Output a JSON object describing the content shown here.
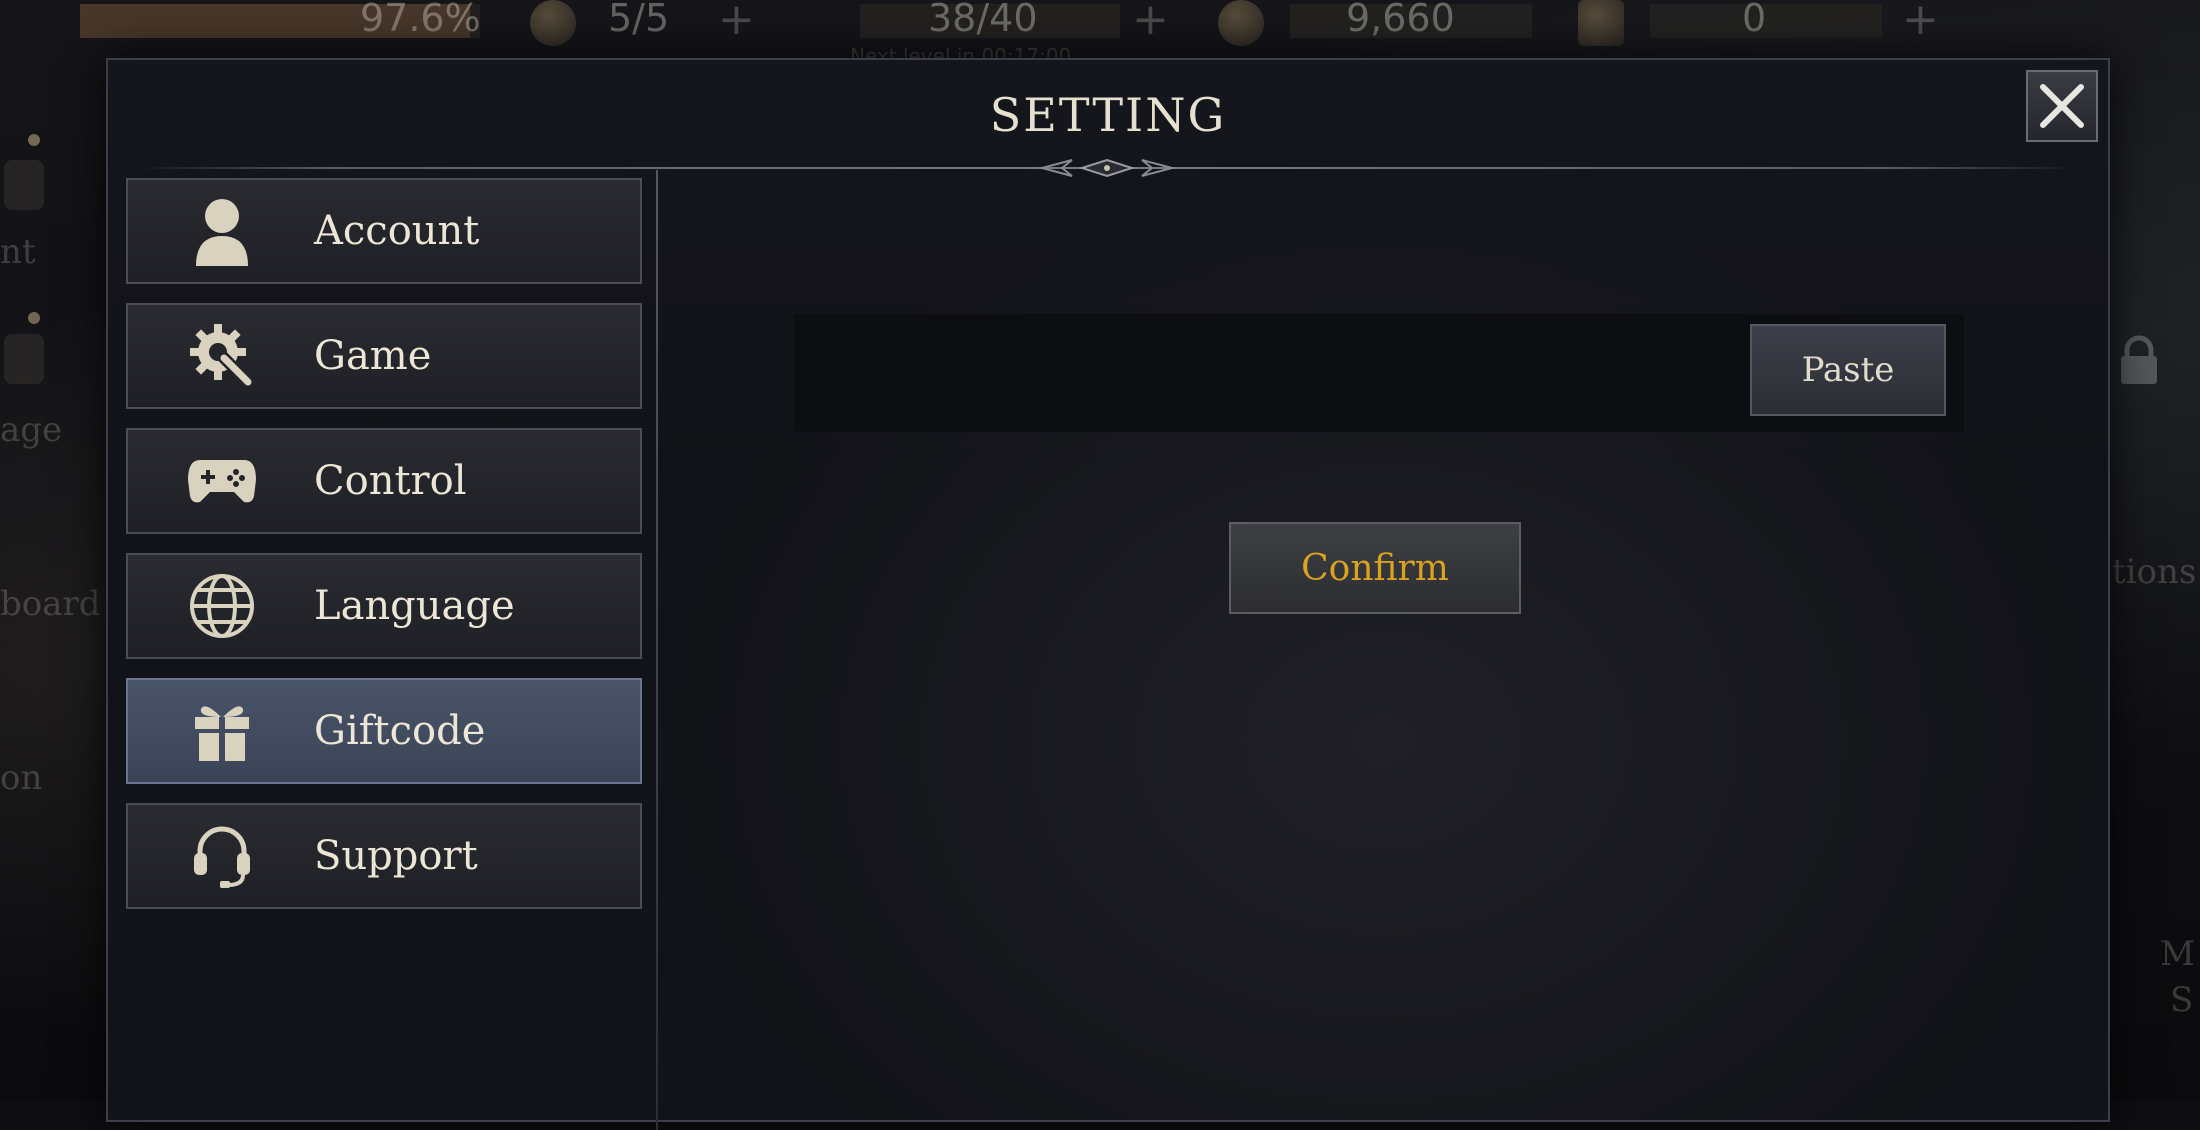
{
  "hud": {
    "progress_text": "97.6%",
    "stamina_text": "5/5",
    "energy_text": "38/40",
    "gold_text": "9,660",
    "gems_text": "0",
    "next_text": "Next level in 00:17:00"
  },
  "dialog": {
    "title": "SETTING",
    "nav_items": [
      {
        "label": "Account",
        "icon": "user-icon"
      },
      {
        "label": "Game",
        "icon": "gear-wrench-icon"
      },
      {
        "label": "Control",
        "icon": "gamepad-icon"
      },
      {
        "label": "Language",
        "icon": "globe-icon"
      },
      {
        "label": "Giftcode",
        "icon": "gift-icon",
        "active": true
      },
      {
        "label": "Support",
        "icon": "headset-icon"
      }
    ],
    "giftcode": {
      "input_value": "",
      "paste_label": "Paste",
      "confirm_label": "Confirm"
    }
  },
  "background": {
    "left_labels": [
      "nt",
      "age",
      "board",
      "on"
    ],
    "right_labels": [
      "tions",
      "M",
      "S"
    ]
  },
  "colors": {
    "accent_gold": "#d9a21f",
    "active_tab": "#4a5468",
    "panel_bg": "#121318"
  }
}
